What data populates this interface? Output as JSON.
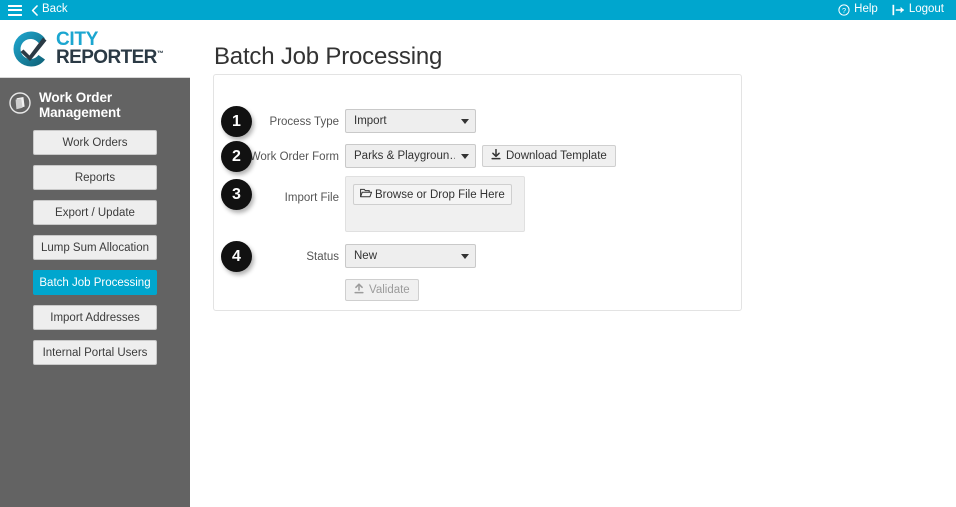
{
  "topbar": {
    "menu_icon": "hamburger-icon",
    "back_label": "Back",
    "back_icon": "chevron-left-icon",
    "help_label": "Help",
    "help_icon": "question-circle-icon",
    "logout_label": "Logout",
    "logout_icon": "sign-out-icon",
    "background": "#00a6ce"
  },
  "brand": {
    "name_line1": "CITY",
    "name_line2": "REPORTER",
    "trademark": "™",
    "logo_icon": "city-reporter-check-logo",
    "color_primary": "#1ba6d0",
    "color_secondary": "#2b3a45"
  },
  "sidebar": {
    "section_icon": "work-order-clipboard-icon",
    "section_title": "Work Order Management",
    "background": "#636363",
    "active_color": "#00a6ce",
    "items": [
      {
        "label": "Work Orders",
        "active": false
      },
      {
        "label": "Reports",
        "active": false
      },
      {
        "label": "Export / Update",
        "active": false
      },
      {
        "label": "Lump Sum Allocation",
        "active": false
      },
      {
        "label": "Batch Job Processing",
        "active": true
      },
      {
        "label": "Import Addresses",
        "active": false
      },
      {
        "label": "Internal Portal Users",
        "active": false
      }
    ]
  },
  "main": {
    "page_title": "Batch Job Processing",
    "steps": [
      {
        "number": "1",
        "label": "Process Type",
        "control": "select",
        "value": "Import"
      },
      {
        "number": "2",
        "label": "Work Order Form",
        "control": "select",
        "value": "Parks & Playgroun…",
        "action_label": "Download Template",
        "action_icon": "download-icon"
      },
      {
        "number": "3",
        "label": "Import File",
        "control": "dropzone",
        "value": "Browse or Drop File Here",
        "dropzone_icon": "folder-open-icon"
      },
      {
        "number": "4",
        "label": "Status",
        "control": "select",
        "value": "New"
      }
    ],
    "validate_button": {
      "label": "Validate",
      "icon": "upload-icon",
      "disabled": true
    }
  }
}
